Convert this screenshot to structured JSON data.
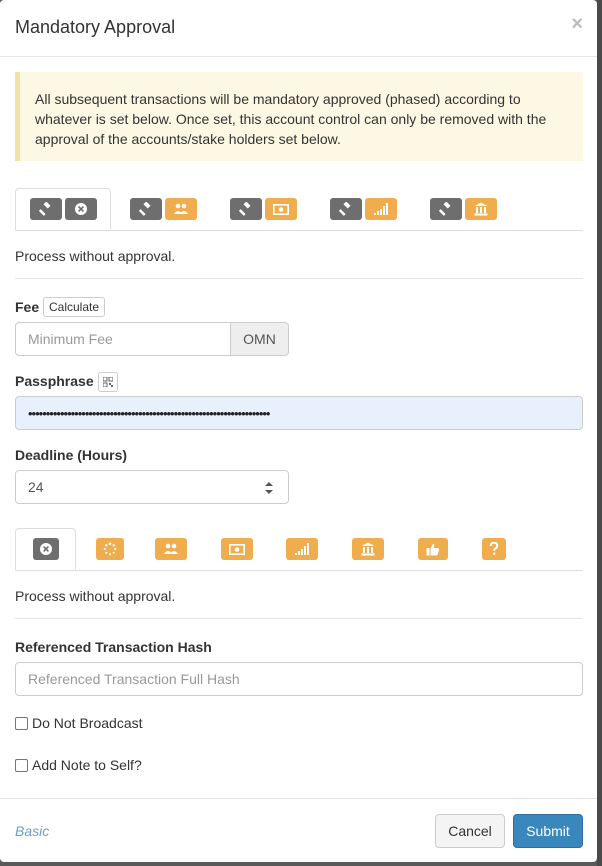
{
  "modal": {
    "title": "Mandatory Approval",
    "close_label": "×"
  },
  "alert": {
    "text": "All subsequent transactions will be mandatory approved (phased) according to whatever is set below. Once set, this account control can only be removed with the approval of the accounts/stake holders set below."
  },
  "control_tabs": {
    "active_index": 0,
    "tabs": [
      {
        "icons": [
          "gavel-icon",
          "times-circle-icon"
        ]
      },
      {
        "icons": [
          "gavel-icon",
          "users-icon"
        ]
      },
      {
        "icons": [
          "gavel-icon",
          "money-icon"
        ]
      },
      {
        "icons": [
          "gavel-icon",
          "signal-icon"
        ]
      },
      {
        "icons": [
          "gavel-icon",
          "bank-icon"
        ]
      }
    ],
    "description": "Process without approval."
  },
  "fee": {
    "label": "Fee",
    "calculate_label": "Calculate",
    "placeholder": "Minimum Fee",
    "unit": "OMN"
  },
  "passphrase": {
    "label": "Passphrase",
    "value": "••••••••••••••••••••••••••••••••••••••••••••••••••••••••••••••••••••"
  },
  "deadline": {
    "label": "Deadline (Hours)",
    "value": "24"
  },
  "phasing_tabs": {
    "active_index": 0,
    "tabs": [
      {
        "icon": "times-circle-icon"
      },
      {
        "icon": "spinner-icon"
      },
      {
        "icon": "users-icon"
      },
      {
        "icon": "money-icon"
      },
      {
        "icon": "signal-icon"
      },
      {
        "icon": "bank-icon"
      },
      {
        "icon": "thumbs-up-icon"
      },
      {
        "icon": "question-icon"
      }
    ],
    "description": "Process without approval."
  },
  "referenced_hash": {
    "label": "Referenced Transaction Hash",
    "placeholder": "Referenced Transaction Full Hash"
  },
  "options": {
    "do_not_broadcast": "Do Not Broadcast",
    "add_note": "Add Note to Self?"
  },
  "footer": {
    "basic_label": "Basic",
    "cancel_label": "Cancel",
    "submit_label": "Submit"
  },
  "colors": {
    "accent": "#3a87be",
    "warning_bg": "#fcf8e3",
    "icon_orange": "#f0ad4e",
    "icon_gray": "#6e6e6e"
  }
}
